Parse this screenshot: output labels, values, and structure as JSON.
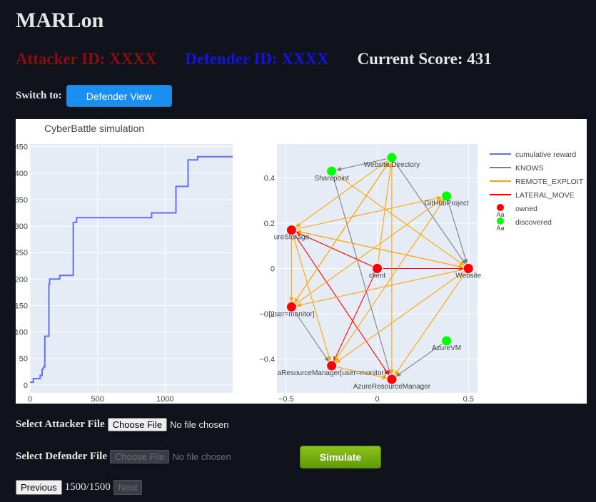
{
  "app_title": "MARLon",
  "header": {
    "attacker_label": "Attacker ID: XXXX",
    "defender_label": "Defender ID: XXXX",
    "score_label": "Current Score: 431"
  },
  "switch": {
    "label": "Switch to:",
    "button_label": "Defender View"
  },
  "files": {
    "attacker_label": "Select Attacker File",
    "attacker_button": "Choose File",
    "attacker_status": "No file chosen",
    "defender_label": "Select Defender File",
    "defender_button": "Choose File",
    "defender_status": "No file chosen"
  },
  "simulate_label": "Simulate",
  "pager": {
    "previous": "Previous",
    "indicator": "1500/1500",
    "next": "Next"
  },
  "colors": {
    "reward_line": "#636efa",
    "knows": "#808080",
    "remote_exploit": "#ffa500",
    "lateral_move": "#ff0000",
    "owned": "#ff0000",
    "discovered": "#00ff00",
    "primary_button": "#1a8ff0",
    "simulate_button": "#6aa60c"
  },
  "chart_data": [
    {
      "type": "line",
      "title": "CyberBattle simulation",
      "xlim": [
        0,
        1500
      ],
      "ylim": [
        -15,
        455
      ],
      "xticks": [
        0,
        500,
        1000
      ],
      "yticks": [
        0,
        50,
        100,
        150,
        200,
        250,
        300,
        350,
        400,
        450
      ],
      "grid": true,
      "series": [
        {
          "name": "cumulative reward",
          "x": [
            0,
            25,
            25,
            75,
            75,
            90,
            90,
            100,
            100,
            110,
            110,
            140,
            140,
            145,
            145,
            150,
            150,
            220,
            220,
            320,
            320,
            345,
            345,
            900,
            900,
            1080,
            1080,
            1170,
            1170,
            1240,
            1240,
            1500
          ],
          "y": [
            5,
            5,
            12,
            12,
            18,
            18,
            30,
            30,
            34,
            34,
            92,
            92,
            190,
            190,
            200,
            200,
            200,
            200,
            207,
            207,
            307,
            307,
            316,
            316,
            325,
            325,
            375,
            375,
            425,
            425,
            431,
            431
          ]
        }
      ]
    },
    {
      "type": "scatter",
      "xlim": [
        -0.55,
        0.55
      ],
      "ylim": [
        -0.55,
        0.55
      ],
      "xticks": [
        -0.5,
        0,
        0.5
      ],
      "yticks": [
        -0.4,
        -0.2,
        0,
        0.2,
        0.4
      ],
      "grid": true,
      "legend": "right",
      "nodes": [
        {
          "id": "client",
          "label": "client",
          "x": 0.0,
          "y": 0.0,
          "status": "owned"
        },
        {
          "id": "website",
          "label": "Website",
          "x": 0.5,
          "y": 0.0,
          "status": "owned"
        },
        {
          "id": "storage",
          "label": "ureStorage",
          "x": -0.47,
          "y": 0.17,
          "status": "owned"
        },
        {
          "id": "monitor",
          "label": "[user=monitor]",
          "x": -0.47,
          "y": -0.17,
          "status": "owned"
        },
        {
          "id": "azrm_mon",
          "label": "aResourceManager[user=monitor]",
          "x": -0.25,
          "y": -0.43,
          "status": "owned"
        },
        {
          "id": "azrm",
          "label": "AzureResourceManager",
          "x": 0.08,
          "y": -0.49,
          "status": "owned"
        },
        {
          "id": "sharepoint",
          "label": "Sharepoint",
          "x": -0.25,
          "y": 0.43,
          "status": "discovered"
        },
        {
          "id": "webdir",
          "label": "Website.Directory",
          "x": 0.08,
          "y": 0.49,
          "status": "discovered"
        },
        {
          "id": "github",
          "label": "GitHubProject",
          "x": 0.38,
          "y": 0.32,
          "status": "discovered"
        },
        {
          "id": "azurevm",
          "label": "AzureVM",
          "x": 0.38,
          "y": -0.32,
          "status": "discovered"
        }
      ],
      "edges": [
        {
          "from": "webdir",
          "to": "sharepoint",
          "kind": "KNOWS"
        },
        {
          "from": "webdir",
          "to": "website",
          "kind": "KNOWS"
        },
        {
          "from": "github",
          "to": "website",
          "kind": "KNOWS"
        },
        {
          "from": "sharepoint",
          "to": "azrm",
          "kind": "KNOWS"
        },
        {
          "from": "monitor",
          "to": "azrm_mon",
          "kind": "KNOWS"
        },
        {
          "from": "azurevm",
          "to": "azrm",
          "kind": "KNOWS"
        },
        {
          "from": "client",
          "to": "storage",
          "kind": "LATERAL_MOVE"
        },
        {
          "from": "client",
          "to": "website",
          "kind": "LATERAL_MOVE"
        },
        {
          "from": "client",
          "to": "azrm_mon",
          "kind": "LATERAL_MOVE"
        },
        {
          "from": "storage",
          "to": "azrm",
          "kind": "LATERAL_MOVE"
        },
        {
          "from": "client",
          "to": "webdir",
          "kind": "REMOTE_EXPLOIT"
        },
        {
          "from": "webdir",
          "to": "storage",
          "kind": "REMOTE_EXPLOIT"
        },
        {
          "from": "webdir",
          "to": "monitor",
          "kind": "REMOTE_EXPLOIT"
        },
        {
          "from": "webdir",
          "to": "azrm",
          "kind": "REMOTE_EXPLOIT"
        },
        {
          "from": "sharepoint",
          "to": "website",
          "kind": "REMOTE_EXPLOIT"
        },
        {
          "from": "storage",
          "to": "github",
          "kind": "REMOTE_EXPLOIT"
        },
        {
          "from": "storage",
          "to": "website",
          "kind": "REMOTE_EXPLOIT"
        },
        {
          "from": "storage",
          "to": "monitor",
          "kind": "REMOTE_EXPLOIT"
        },
        {
          "from": "storage",
          "to": "azrm_mon",
          "kind": "REMOTE_EXPLOIT"
        },
        {
          "from": "monitor",
          "to": "github",
          "kind": "REMOTE_EXPLOIT"
        },
        {
          "from": "monitor",
          "to": "webdir",
          "kind": "REMOTE_EXPLOIT"
        },
        {
          "from": "website",
          "to": "storage",
          "kind": "REMOTE_EXPLOIT"
        },
        {
          "from": "website",
          "to": "monitor",
          "kind": "REMOTE_EXPLOIT"
        },
        {
          "from": "website",
          "to": "azrm_mon",
          "kind": "REMOTE_EXPLOIT"
        },
        {
          "from": "website",
          "to": "azrm",
          "kind": "REMOTE_EXPLOIT"
        },
        {
          "from": "github",
          "to": "azrm_mon",
          "kind": "REMOTE_EXPLOIT"
        },
        {
          "from": "azrm_mon",
          "to": "azrm",
          "kind": "REMOTE_EXPLOIT"
        }
      ]
    }
  ],
  "legend": [
    {
      "label": "cumulative reward",
      "kind": "line",
      "color": "#636efa"
    },
    {
      "label": "KNOWS",
      "kind": "line",
      "color": "#808080"
    },
    {
      "label": "REMOTE_EXPLOIT",
      "kind": "line",
      "color": "#ffa500"
    },
    {
      "label": "LATERAL_MOVE",
      "kind": "line",
      "color": "#ff0000"
    },
    {
      "label": "owned",
      "kind": "marker",
      "color": "#ff0000"
    },
    {
      "label": "discovered",
      "kind": "marker",
      "color": "#00ff00"
    }
  ]
}
